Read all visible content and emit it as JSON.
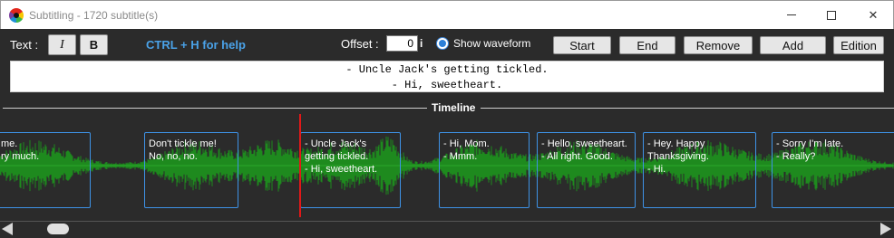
{
  "window": {
    "title": "Subtitling - 1720 subtitle(s)"
  },
  "toolbar": {
    "text_label": "Text :",
    "italic_label": "I",
    "bold_label": "B",
    "help_text": "CTRL + H for help",
    "offset_label": "Offset :",
    "offset_value": "0",
    "offset_unit": "i",
    "show_waveform_label": "Show waveform",
    "show_waveform_checked": true,
    "start_label": "Start",
    "end_label": "End",
    "remove_label": "Remove",
    "add_label": "Add",
    "edition_label": "Edition"
  },
  "current_subtitle": {
    "line1": "- Uncle Jack's getting tickled.",
    "line2": "- Hi, sweetheart."
  },
  "timeline": {
    "label": "Timeline",
    "subtitles": [
      {
        "lines": [
          "me.",
          "ry much."
        ]
      },
      {
        "lines": [
          "Don't tickle me!",
          "No, no, no."
        ]
      },
      {
        "lines": [
          "- Uncle Jack's",
          "getting tickled.",
          "- Hi, sweetheart."
        ]
      },
      {
        "lines": [
          "- Hi, Mom.",
          "- Mmm."
        ]
      },
      {
        "lines": [
          "- Hello, sweetheart.",
          "- All right. Good."
        ]
      },
      {
        "lines": [
          "- Hey. Happy",
          "Thanksgiving.",
          "- Hi."
        ]
      },
      {
        "lines": [
          "- Sorry I'm late.",
          "- Really?"
        ]
      }
    ]
  },
  "colors": {
    "background": "#2b2b2b",
    "waveform": "#1e8a1e",
    "subtitle_border": "#3e92e6",
    "playhead": "#e21818",
    "help_text": "#4aa2e8"
  }
}
